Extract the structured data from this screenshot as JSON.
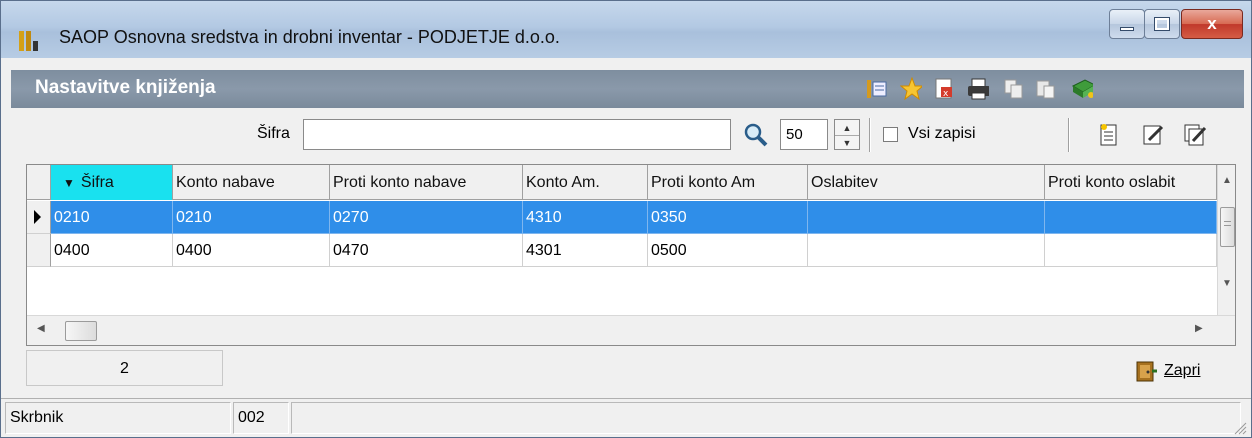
{
  "window": {
    "title": "SAOP  Osnovna sredstva in drobni inventar  - PODJETJE d.o.o.",
    "controls": {
      "minimize": "minimize",
      "maximize": "maximize",
      "close": "x"
    }
  },
  "header": {
    "title": "Nastavitve knjiženja",
    "icons": [
      "columns-icon",
      "star-icon",
      "export-icon",
      "print-icon",
      "copy-icon",
      "paste-icon",
      "exit-book-icon"
    ]
  },
  "search": {
    "label": "Šifra",
    "value": "",
    "count": "50",
    "all_records_label": "Vsi zapisi",
    "all_records_checked": false,
    "actions": [
      "new-record-icon",
      "edit-record-icon",
      "edit-multi-icon"
    ]
  },
  "table": {
    "columns": [
      "Šifra",
      "Konto nabave",
      "Proti konto nabave",
      "Konto Am.",
      "Proti konto Am",
      "Oslabitev",
      "Proti konto oslabit"
    ],
    "sorted_column": "Šifra",
    "rows": [
      {
        "selected": true,
        "cells": [
          "0210",
          "0210",
          "0270",
          "4310",
          "0350",
          "",
          ""
        ]
      },
      {
        "selected": false,
        "cells": [
          "0400",
          "0400",
          "0470",
          "4301",
          "0500",
          "",
          ""
        ]
      }
    ]
  },
  "footer": {
    "record_count": "2",
    "close_label": "Zapri"
  },
  "statusbar": {
    "user_label": "Skrbnik",
    "user_code": "002"
  },
  "colors": {
    "selected_row": "#2f8ee9",
    "sorted_header": "#19e1ef",
    "header_panel": "#8a99aa"
  }
}
